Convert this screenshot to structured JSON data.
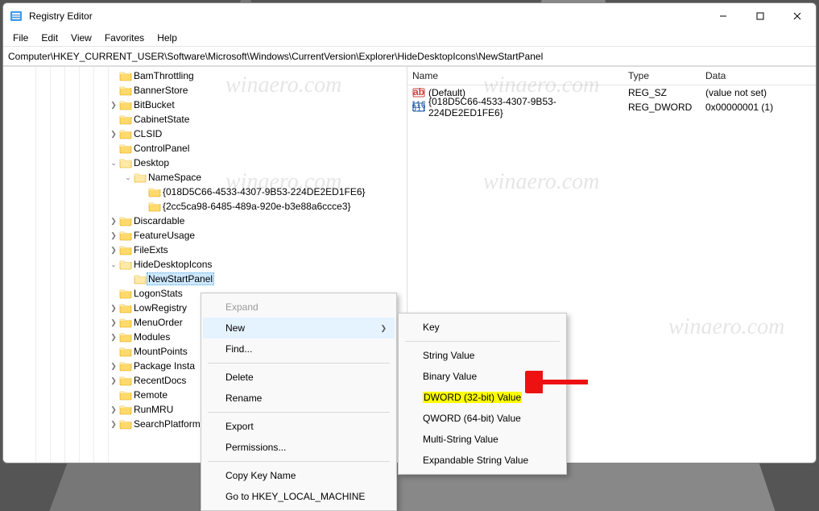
{
  "window": {
    "title": "Registry Editor"
  },
  "menubar": [
    "File",
    "Edit",
    "View",
    "Favorites",
    "Help"
  ],
  "address": "Computer\\HKEY_CURRENT_USER\\Software\\Microsoft\\Windows\\CurrentVersion\\Explorer\\HideDesktopIcons\\NewStartPanel",
  "tree": [
    {
      "indent": 160,
      "twisty": "",
      "label": "BamThrottling"
    },
    {
      "indent": 160,
      "twisty": "",
      "label": "BannerStore"
    },
    {
      "indent": 160,
      "twisty": ">",
      "label": "BitBucket"
    },
    {
      "indent": 160,
      "twisty": "",
      "label": "CabinetState"
    },
    {
      "indent": 160,
      "twisty": ">",
      "label": "CLSID"
    },
    {
      "indent": 160,
      "twisty": "",
      "label": "ControlPanel"
    },
    {
      "indent": 160,
      "twisty": "v",
      "label": "Desktop"
    },
    {
      "indent": 178,
      "twisty": "v",
      "label": "NameSpace"
    },
    {
      "indent": 196,
      "twisty": "",
      "label": "{018D5C66-4533-4307-9B53-224DE2ED1FE6}"
    },
    {
      "indent": 196,
      "twisty": "",
      "label": "{2cc5ca98-6485-489a-920e-b3e88a6ccce3}"
    },
    {
      "indent": 160,
      "twisty": ">",
      "label": "Discardable"
    },
    {
      "indent": 160,
      "twisty": ">",
      "label": "FeatureUsage"
    },
    {
      "indent": 160,
      "twisty": ">",
      "label": "FileExts"
    },
    {
      "indent": 160,
      "twisty": "v",
      "label": "HideDesktopIcons"
    },
    {
      "indent": 178,
      "twisty": "",
      "label": "NewStartPanel",
      "selected": true
    },
    {
      "indent": 160,
      "twisty": "",
      "label": "LogonStats"
    },
    {
      "indent": 160,
      "twisty": ">",
      "label": "LowRegistry"
    },
    {
      "indent": 160,
      "twisty": ">",
      "label": "MenuOrder"
    },
    {
      "indent": 160,
      "twisty": ">",
      "label": "Modules"
    },
    {
      "indent": 160,
      "twisty": "",
      "label": "MountPoints"
    },
    {
      "indent": 160,
      "twisty": ">",
      "label": "Package Insta"
    },
    {
      "indent": 160,
      "twisty": ">",
      "label": "RecentDocs"
    },
    {
      "indent": 160,
      "twisty": "",
      "label": "Remote"
    },
    {
      "indent": 160,
      "twisty": ">",
      "label": "RunMRU"
    },
    {
      "indent": 160,
      "twisty": ">",
      "label": "SearchPlatform"
    }
  ],
  "values": {
    "headers": {
      "name": "Name",
      "type": "Type",
      "data": "Data"
    },
    "rows": [
      {
        "icon": "ab",
        "name": "(Default)",
        "type": "REG_SZ",
        "data": "(value not set)"
      },
      {
        "icon": "bin",
        "name": "{018D5C66-4533-4307-9B53-224DE2ED1FE6}",
        "type": "REG_DWORD",
        "data": "0x00000001 (1)"
      }
    ]
  },
  "context_main": [
    {
      "label": "Expand",
      "disabled": true
    },
    {
      "label": "New",
      "submenu": true,
      "hover": true
    },
    {
      "label": "Find...",
      "sepAfter": true
    },
    {
      "label": "Delete"
    },
    {
      "label": "Rename",
      "sepAfter": true
    },
    {
      "label": "Export"
    },
    {
      "label": "Permissions...",
      "sepAfter": true
    },
    {
      "label": "Copy Key Name"
    },
    {
      "label": "Go to HKEY_LOCAL_MACHINE"
    }
  ],
  "context_sub": [
    {
      "label": "Key",
      "sepAfter": true
    },
    {
      "label": "String Value"
    },
    {
      "label": "Binary Value"
    },
    {
      "label": "DWORD (32-bit) Value",
      "highlight": true
    },
    {
      "label": "QWORD (64-bit) Value"
    },
    {
      "label": "Multi-String Value"
    },
    {
      "label": "Expandable String Value"
    }
  ],
  "watermarks": [
    "winaero.com",
    "winaero.com",
    "winaero.com",
    "winaero.com"
  ]
}
